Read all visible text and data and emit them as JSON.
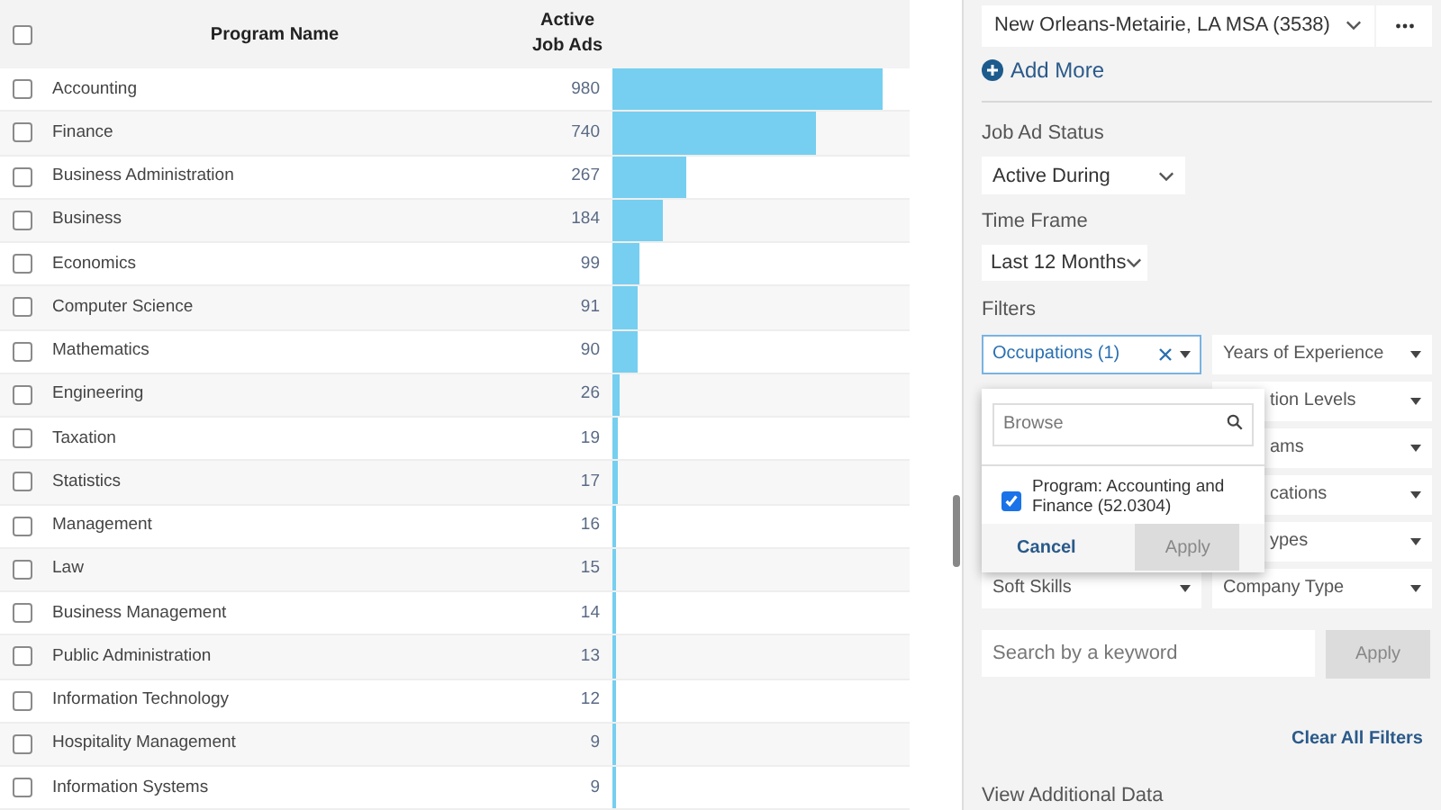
{
  "table": {
    "columns": [
      "Program Name",
      "Active Job Ads"
    ],
    "all_checked": false,
    "rows": [
      {
        "name": "Accounting",
        "count": "980",
        "checked": false
      },
      {
        "name": "Finance",
        "count": "740",
        "checked": false
      },
      {
        "name": "Business Administration",
        "count": "267",
        "checked": false
      },
      {
        "name": "Business",
        "count": "184",
        "checked": false
      },
      {
        "name": "Economics",
        "count": "99",
        "checked": false
      },
      {
        "name": "Computer Science",
        "count": "91",
        "checked": false
      },
      {
        "name": "Mathematics",
        "count": "90",
        "checked": false
      },
      {
        "name": "Engineering",
        "count": "26",
        "checked": false
      },
      {
        "name": "Taxation",
        "count": "19",
        "checked": false
      },
      {
        "name": "Statistics",
        "count": "17",
        "checked": false
      },
      {
        "name": "Management",
        "count": "16",
        "checked": false
      },
      {
        "name": "Law",
        "count": "15",
        "checked": false
      },
      {
        "name": "Business Management",
        "count": "14",
        "checked": false
      },
      {
        "name": "Public Administration",
        "count": "13",
        "checked": false
      },
      {
        "name": "Information Technology",
        "count": "12",
        "checked": false
      },
      {
        "name": "Hospitality Management",
        "count": "9",
        "checked": false
      },
      {
        "name": "Information Systems",
        "count": "9",
        "checked": false
      }
    ]
  },
  "sidebar": {
    "location": "New Orleans-Metairie, LA MSA (3538)",
    "add_more": "Add More",
    "job_ad_status": {
      "label": "Job Ad Status",
      "value": "Active During"
    },
    "time_frame": {
      "label": "Time Frame",
      "value": "Last 12 Months"
    },
    "filters_label": "Filters",
    "filters_left": [
      {
        "label": "Occupations (1)",
        "active": true
      },
      {
        "label": "Soft Skills",
        "active": false
      }
    ],
    "filters_right": [
      {
        "label": "Years of Experience",
        "active": false,
        "covered": false
      },
      {
        "label": "tion Levels",
        "active": false,
        "covered": true
      },
      {
        "label": "ams",
        "active": false,
        "covered": true
      },
      {
        "label": "cations",
        "active": false,
        "covered": true
      },
      {
        "label": "ypes",
        "active": false,
        "covered": true
      },
      {
        "label": "Company Type",
        "active": false,
        "covered": false
      }
    ],
    "popup": {
      "placeholder": "Browse",
      "options": [
        {
          "label": "Program: Accounting and Finance (52.0304)",
          "checked": true
        }
      ],
      "cancel": "Cancel",
      "apply": "Apply"
    },
    "keyword": {
      "placeholder": "Search by a keyword"
    },
    "apply": "Apply",
    "clear": "Clear All Filters",
    "view_more": "View Additional Data"
  }
}
